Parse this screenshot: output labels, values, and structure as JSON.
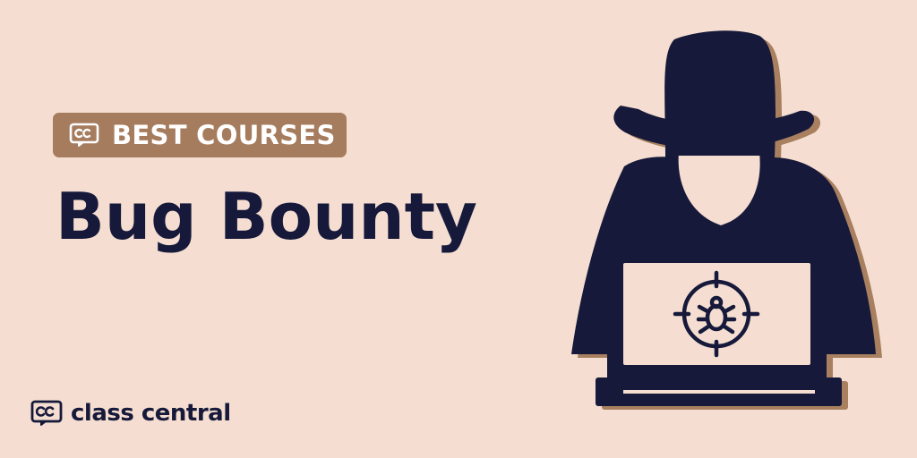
{
  "badge": {
    "icon": "cc-logo-icon",
    "label": "BEST COURSES"
  },
  "headline": "Bug Bounty",
  "brand": {
    "icon": "cc-logo-icon",
    "name": "class central"
  },
  "illustration": {
    "figure": "hacker-figure",
    "laptop_icon": "bug-target-icon"
  },
  "colors": {
    "background": "#F5DED1",
    "badge": "#A67C5E",
    "navy": "#16193A",
    "shadow": "#A8805F",
    "white": "#FFFFFF"
  }
}
